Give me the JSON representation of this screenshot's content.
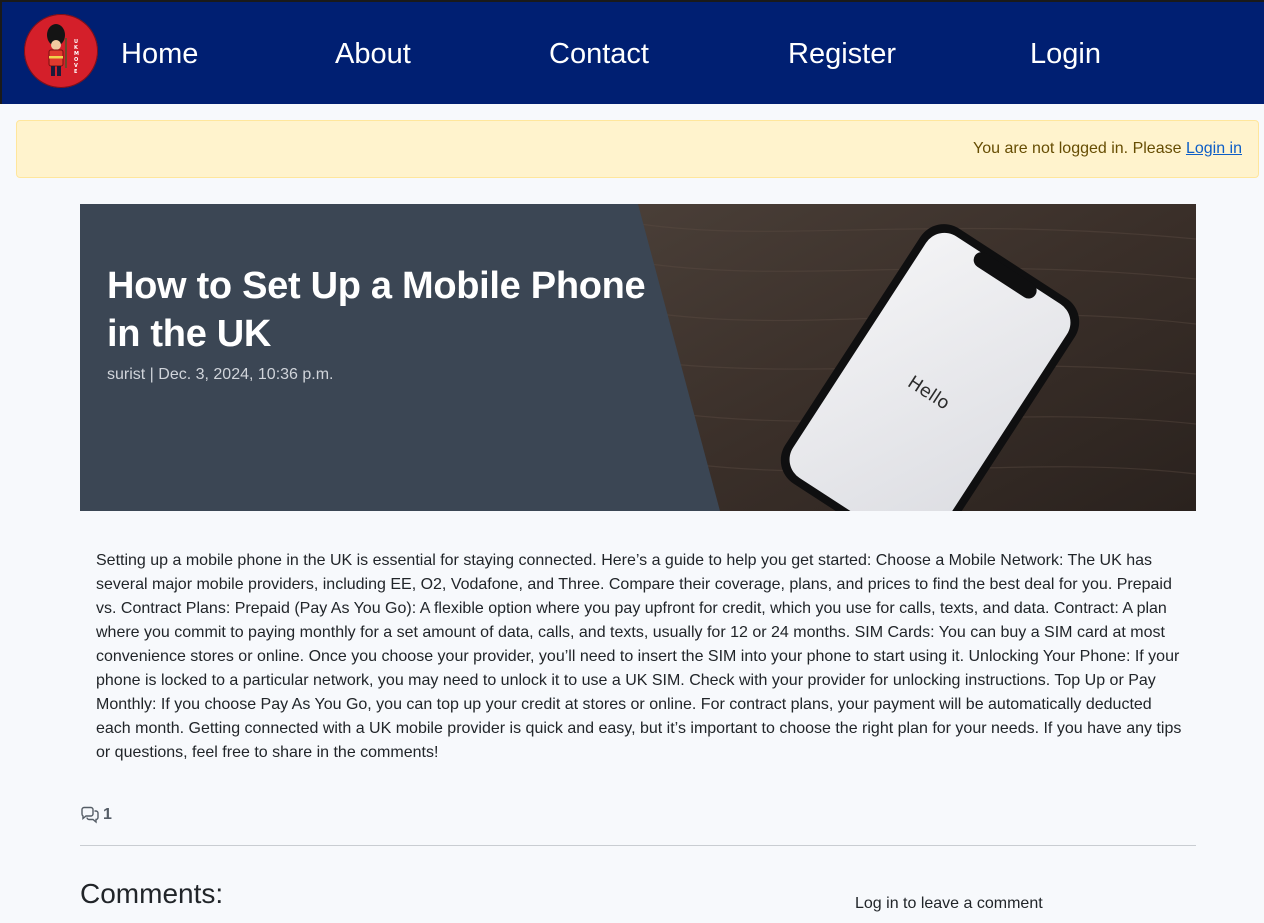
{
  "nav": {
    "items": [
      {
        "label": "Home"
      },
      {
        "label": "About"
      },
      {
        "label": "Contact"
      },
      {
        "label": "Register"
      },
      {
        "label": "Login"
      }
    ],
    "logo_text": "UKMOVE"
  },
  "alert": {
    "message": "You are not logged in. Please",
    "link_label": "Login in"
  },
  "post": {
    "title": "How to Set Up a Mobile Phone in the UK",
    "meta": "surist | Dec. 3, 2024, 10:36 p.m.",
    "image_text": "Hello",
    "body": "Setting up a mobile phone in the UK is essential for staying connected. Here’s a guide to help you get started: Choose a Mobile Network: The UK has several major mobile providers, including EE, O2, Vodafone, and Three. Compare their coverage, plans, and prices to find the best deal for you. Prepaid vs. Contract Plans: Prepaid (Pay As You Go): A flexible option where you pay upfront for credit, which you use for calls, texts, and data. Contract: A plan where you commit to paying monthly for a set amount of data, calls, and texts, usually for 12 or 24 months. SIM Cards: You can buy a SIM card at most convenience stores or online. Once you choose your provider, you’ll need to insert the SIM into your phone to start using it. Unlocking Your Phone: If your phone is locked to a particular network, you may need to unlock it to use a UK SIM. Check with your provider for unlocking instructions. Top Up or Pay Monthly: If you choose Pay As You Go, you can top up your credit at stores or online. For contract plans, your payment will be automatically deducted each month. Getting connected with a UK mobile provider is quick and easy, but it’s important to choose the right plan for your needs. If you have any tips or questions, feel free to share in the comments!",
    "comment_count": "1"
  },
  "comments": {
    "heading": "Comments:",
    "login_prompt": "Log in to leave a comment"
  },
  "icons": {
    "comment": "comments-icon",
    "logo": "guard-logo-icon"
  },
  "colors": {
    "navbar": "#001f72",
    "alert_bg": "#fff3cd",
    "hero_panel": "#3b4654",
    "link": "#0d5ec7"
  }
}
